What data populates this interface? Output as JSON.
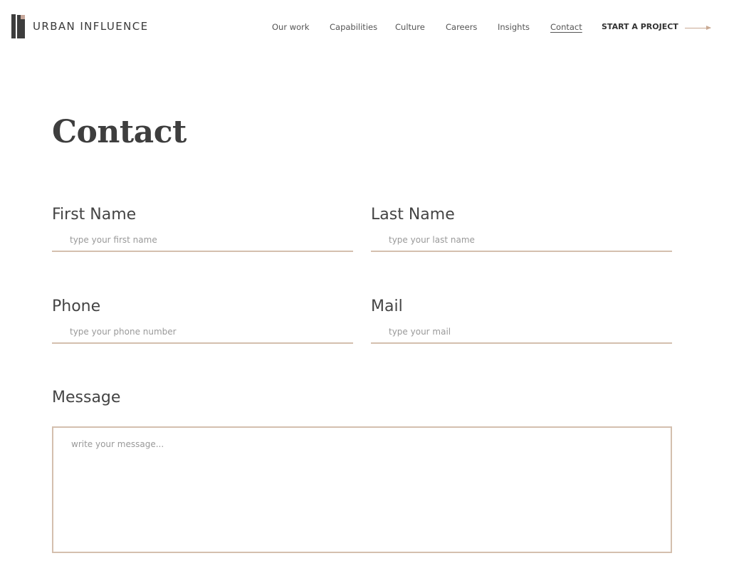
{
  "brand": {
    "name": "URBAN INFLUENCE",
    "accent": "#c9a993"
  },
  "nav": {
    "items": [
      "Our work",
      "Capabilities",
      "Culture",
      "Careers",
      "Insights",
      "Contact"
    ],
    "active": "Contact",
    "cta": "START A PROJECT",
    "cta_icon": "arrow-right-icon"
  },
  "page": {
    "title": "Contact"
  },
  "form": {
    "first_name": {
      "label": "First Name",
      "placeholder": "type your first name",
      "value": ""
    },
    "last_name": {
      "label": "Last Name",
      "placeholder": "type your last name",
      "value": ""
    },
    "phone": {
      "label": "Phone",
      "placeholder": "type your phone number",
      "value": ""
    },
    "mail": {
      "label": "Mail",
      "placeholder": "type your mail",
      "value": ""
    },
    "message": {
      "label": "Message",
      "placeholder": "write your message...",
      "value": ""
    }
  }
}
